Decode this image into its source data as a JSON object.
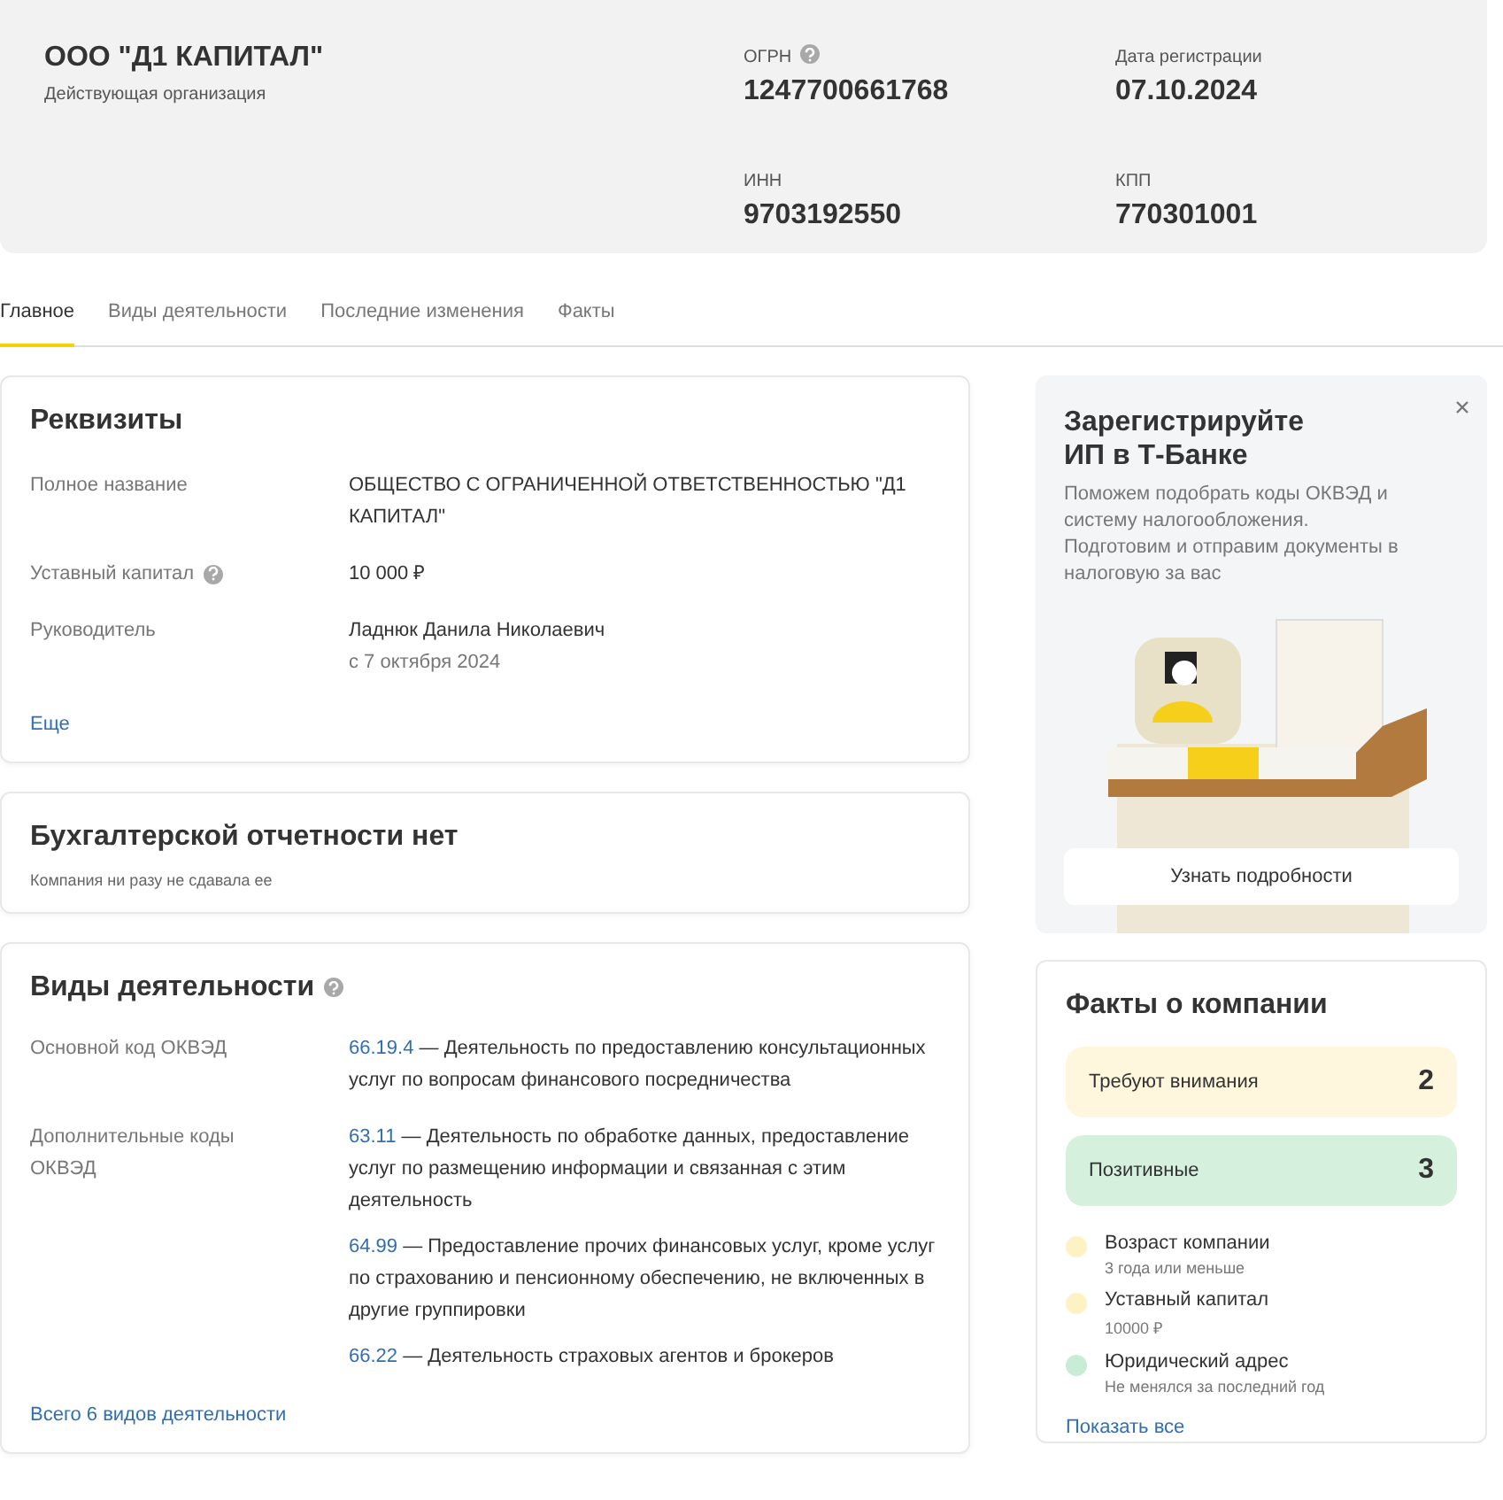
{
  "header": {
    "company_name": "ООО \"Д1 КАПИТАЛ\"",
    "status": "Действующая организация",
    "fields": [
      {
        "label": "ОГРН",
        "value": "1247700661768",
        "help": true
      },
      {
        "label": "Дата регистрации",
        "value": "07.10.2024",
        "help": false
      },
      {
        "label": "ИНН",
        "value": "9703192550",
        "help": false
      },
      {
        "label": "КПП",
        "value": "770301001",
        "help": false
      }
    ]
  },
  "tabs": [
    {
      "label": "Главное",
      "selected": true
    },
    {
      "label": "Виды деятельности",
      "selected": false
    },
    {
      "label": "Последние изменения",
      "selected": false
    },
    {
      "label": "Факты",
      "selected": false
    }
  ],
  "requisites": {
    "title": "Реквизиты",
    "rows": [
      {
        "label": "Полное название",
        "value": "ОБЩЕСТВО С ОГРАНИЧЕННОЙ ОТВЕТСТВЕННОСТЬЮ \"Д1 КАПИТАЛ\"",
        "help": false
      },
      {
        "label": "Уставный капитал",
        "value": "10 000 ₽",
        "help": true
      },
      {
        "label": "Руководитель",
        "value": "Ладнюк Данила Николаевич",
        "note": "с 7 октября 2024",
        "help": false
      }
    ],
    "more_link": "Еще"
  },
  "accounting": {
    "title": "Бухгалтерской отчетности нет",
    "subtitle": "Компания ни разу не сдавала ее"
  },
  "activities": {
    "title": "Виды деятельности",
    "help": true,
    "groups": [
      {
        "label": "Основной код ОКВЭД",
        "items": [
          {
            "code": "66.19.4",
            "text": " — Деятельность по предоставлению консультационных услуг по вопросам финансового посредничества"
          }
        ]
      },
      {
        "label": "Дополнительные коды ОКВЭД",
        "items": [
          {
            "code": "63.11",
            "text": " — Деятельность по обработке данных, предоставление услуг по размещению информации и связанная с этим деятельность"
          },
          {
            "code": "64.99",
            "text": " — Предоставление прочих финансовых услуг, кроме услуг по страхованию и пенсионному обеспечению, не включенных в другие группировки"
          },
          {
            "code": "66.22",
            "text": " — Деятельность страховых агентов и брокеров"
          }
        ]
      }
    ],
    "all_link": "Всего 6 видов деятельности"
  },
  "promo": {
    "title": "Зарегистрируйте ИП в Т-Банке",
    "text": "Поможем подобрать коды ОКВЭД и систему налогообложения. Подготовим и отправим документы в налоговую за вас",
    "button": "Узнать подробности"
  },
  "facts": {
    "title": "Факты о компании",
    "summary": [
      {
        "kind": "warning",
        "label": "Требуют внимания",
        "count": "2"
      },
      {
        "kind": "positive",
        "label": "Позитивные",
        "count": "3"
      }
    ],
    "items": [
      {
        "title": "Возраст компании",
        "note": "3 года или меньше",
        "color": "#fdf2c4"
      },
      {
        "title": "Уставный капитал",
        "note": "10000 ₽",
        "color": "#fdf2c4"
      },
      {
        "title": "Юридический адрес",
        "note": "Не менялся за последний год",
        "color": "#c9ecd6"
      }
    ],
    "show_all_link": "Показать все"
  }
}
